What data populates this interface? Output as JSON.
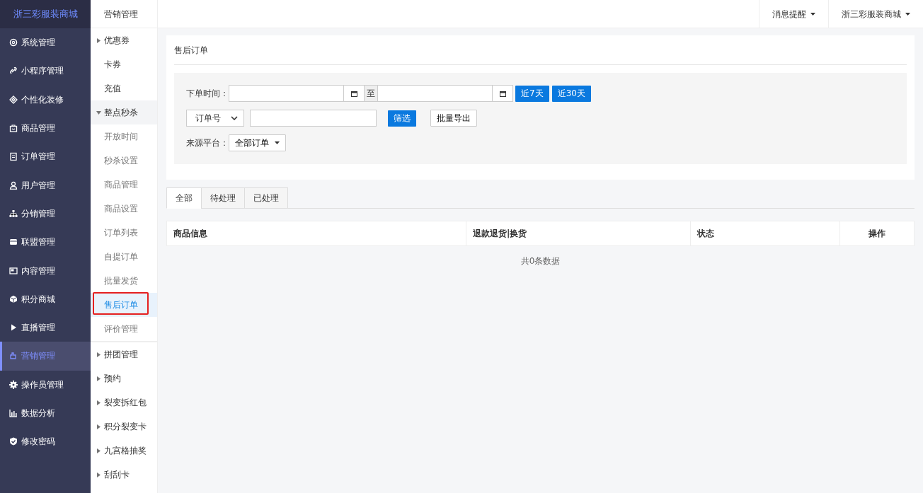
{
  "brand": "浙三彩服装商城",
  "nav": [
    {
      "label": "系统管理",
      "selected": false
    },
    {
      "label": "小程序管理",
      "selected": false
    },
    {
      "label": "个性化装修",
      "selected": false
    },
    {
      "label": "商品管理",
      "selected": false
    },
    {
      "label": "订单管理",
      "selected": false
    },
    {
      "label": "用户管理",
      "selected": false
    },
    {
      "label": "分销管理",
      "selected": false
    },
    {
      "label": "联盟管理",
      "selected": false
    },
    {
      "label": "内容管理",
      "selected": false
    },
    {
      "label": "积分商城",
      "selected": false
    },
    {
      "label": "直播管理",
      "selected": false
    },
    {
      "label": "营销管理",
      "selected": true
    },
    {
      "label": "操作员管理",
      "selected": false
    },
    {
      "label": "数据分析",
      "selected": false
    },
    {
      "label": "修改密码",
      "selected": false
    }
  ],
  "submenu_title": "营销管理",
  "submenu": [
    {
      "kind": "group",
      "label": "优惠券",
      "expanded": false
    },
    {
      "kind": "leaf",
      "label": "卡券",
      "selected": false,
      "annotated": false
    },
    {
      "kind": "leaf",
      "label": "充值",
      "selected": false,
      "annotated": false
    },
    {
      "kind": "group",
      "label": "整点秒杀",
      "expanded": true,
      "children": [
        {
          "label": "开放时间",
          "selected": false,
          "annotated": false
        },
        {
          "label": "秒杀设置",
          "selected": false,
          "annotated": false
        },
        {
          "label": "商品管理",
          "selected": false,
          "annotated": false
        },
        {
          "label": "商品设置",
          "selected": false,
          "annotated": false
        },
        {
          "label": "订单列表",
          "selected": false,
          "annotated": false
        },
        {
          "label": "自提订单",
          "selected": false,
          "annotated": false
        },
        {
          "label": "批量发货",
          "selected": false,
          "annotated": false
        },
        {
          "label": "售后订单",
          "selected": true,
          "annotated": true
        },
        {
          "label": "评价管理",
          "selected": false,
          "annotated": false
        }
      ]
    },
    {
      "kind": "group",
      "label": "拼团管理",
      "expanded": false
    },
    {
      "kind": "group",
      "label": "预约",
      "expanded": false
    },
    {
      "kind": "group",
      "label": "裂变拆红包",
      "expanded": false
    },
    {
      "kind": "group",
      "label": "积分裂变卡",
      "expanded": false
    },
    {
      "kind": "group",
      "label": "九宫格抽奖",
      "expanded": false
    },
    {
      "kind": "group",
      "label": "刮刮卡",
      "expanded": false
    }
  ],
  "topbar": [
    {
      "label": "消息提醒"
    },
    {
      "label": "浙三彩服装商城"
    }
  ],
  "page_title": "售后订单",
  "filters": {
    "date_label": "下单时间：",
    "date_separator": "至",
    "quick_buttons": [
      "近7天",
      "近30天"
    ],
    "search_type": "订单号",
    "filter_button": "筛选",
    "export_button": "批量导出",
    "source_label": "来源平台：",
    "source_value": "全部订单"
  },
  "tabs": [
    {
      "label": "全部",
      "selected": true
    },
    {
      "label": "待处理",
      "selected": false
    },
    {
      "label": "已处理",
      "selected": false
    }
  ],
  "table": {
    "columns": [
      "商品信息",
      "退款退货|换货",
      "状态",
      "操作"
    ],
    "empty_text": "共0条数据"
  }
}
